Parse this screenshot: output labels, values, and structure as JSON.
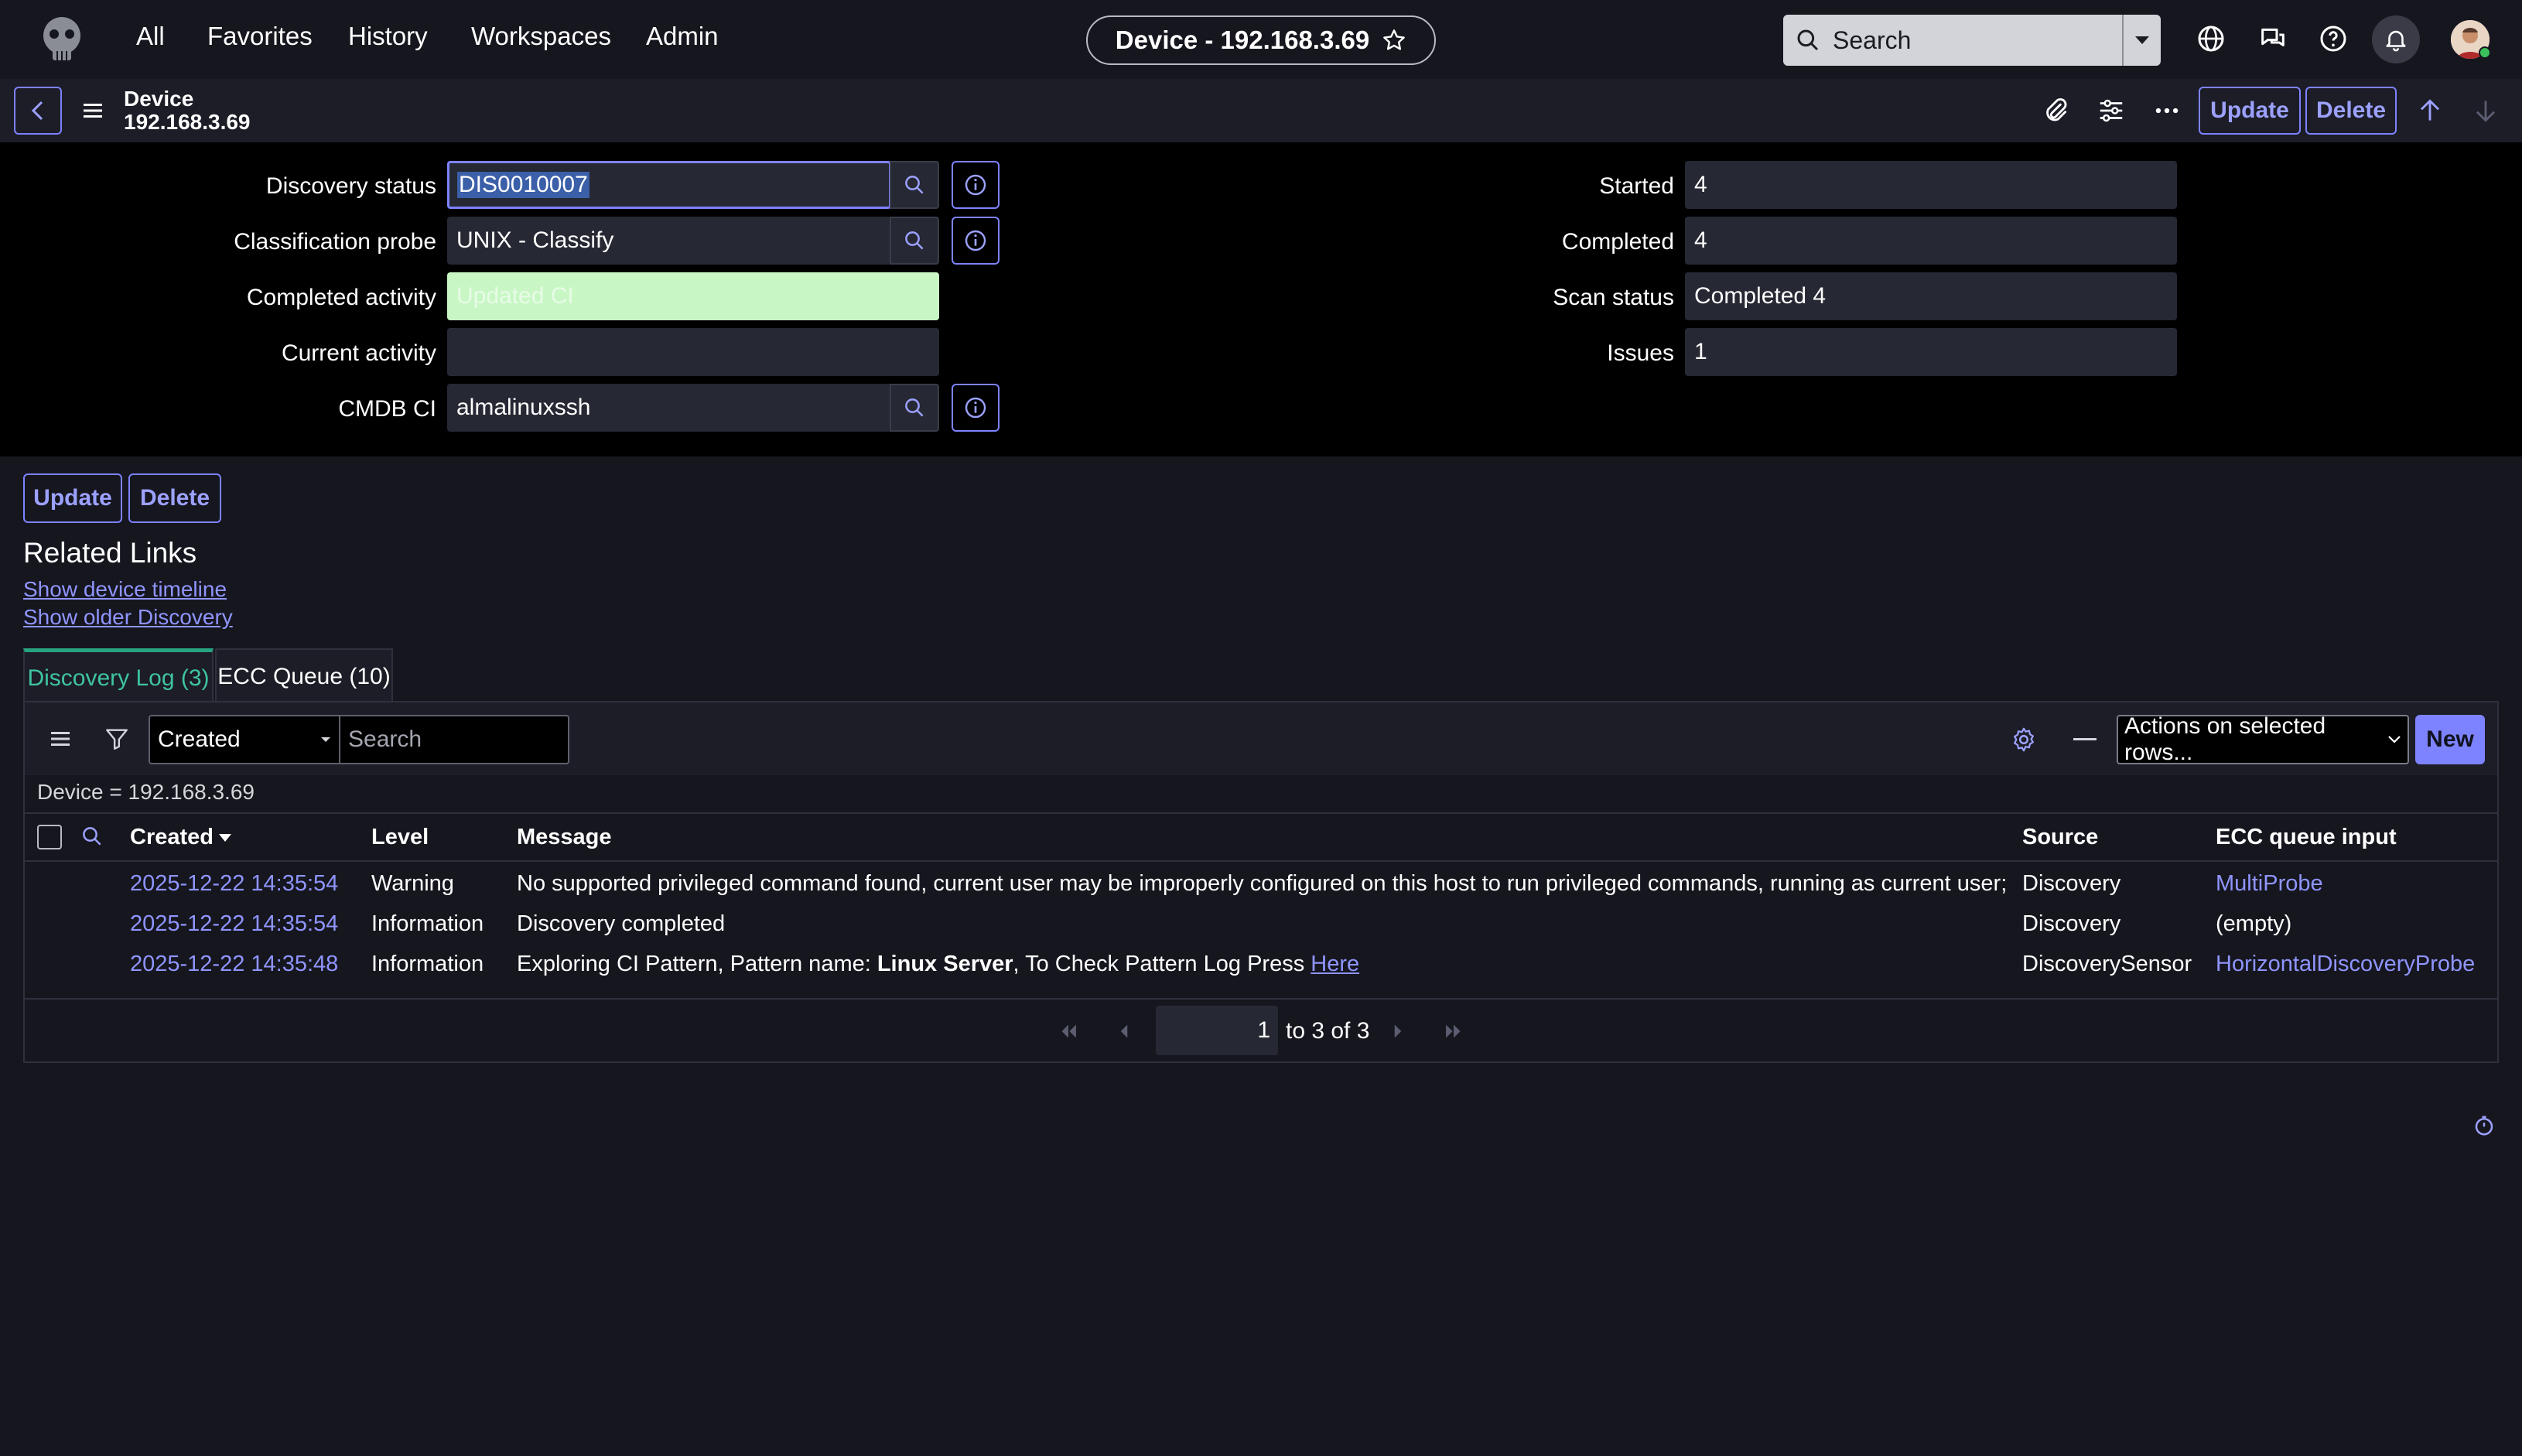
{
  "topnav": {
    "links": [
      "All",
      "Favorites",
      "History",
      "Workspaces",
      "Admin"
    ],
    "title": "Device - 192.168.3.69",
    "search_placeholder": "Search"
  },
  "form_header": {
    "table": "Device",
    "record": "192.168.3.69",
    "update_label": "Update",
    "delete_label": "Delete"
  },
  "form": {
    "left": [
      {
        "label": "Discovery status",
        "value": "DIS0010007"
      },
      {
        "label": "Classification probe",
        "value": "UNIX - Classify"
      },
      {
        "label": "Completed activity",
        "value": "Updated CI"
      },
      {
        "label": "Current activity",
        "value": ""
      },
      {
        "label": "CMDB CI",
        "value": "almalinuxssh"
      }
    ],
    "right": [
      {
        "label": "Started",
        "value": "4"
      },
      {
        "label": "Completed",
        "value": "4"
      },
      {
        "label": "Scan status",
        "value": "Completed 4"
      },
      {
        "label": "Issues",
        "value": "1"
      }
    ]
  },
  "bottom_buttons": {
    "update_label": "Update",
    "delete_label": "Delete"
  },
  "related_links": {
    "title": "Related Links",
    "links": [
      "Show device timeline",
      "Show older Discovery"
    ]
  },
  "tabs": [
    {
      "label": "Discovery Log (3)",
      "active": true
    },
    {
      "label": "ECC Queue (10)",
      "active": false
    }
  ],
  "list": {
    "filter_field": "Created",
    "search_placeholder": "Search",
    "actions_label": "Actions on selected rows...",
    "new_label": "New",
    "breadcrumb": "Device = 192.168.3.69",
    "columns": [
      "Created",
      "Level",
      "Message",
      "Source",
      "ECC queue input"
    ],
    "rows": [
      {
        "created": "2025-12-22 14:35:54",
        "level": "Warning",
        "message": "No supported privileged command found, current user may be improperly configured on this host to run privileged commands, running as current user;",
        "source": "Discovery",
        "ecc": "MultiProbe",
        "ecc_is_link": true
      },
      {
        "created": "2025-12-22 14:35:54",
        "level": "Information",
        "message": "Discovery completed",
        "source": "Discovery",
        "ecc": "(empty)",
        "ecc_is_link": false
      },
      {
        "created": "2025-12-22 14:35:48",
        "level": "Information",
        "message_prefix": "Exploring CI Pattern, Pattern name: ",
        "message_bold": "Linux Server",
        "message_mid": ", To Check Pattern Log Press ",
        "message_link": "Here",
        "source": "DiscoverySensor",
        "ecc": "HorizontalDiscoveryProbe",
        "ecc_is_link": true
      }
    ],
    "pager": {
      "page": "1",
      "range_text": "to 3 of 3"
    }
  },
  "colors": {
    "accent": "#7d83ff",
    "link": "#8f95ff",
    "tab_active": "#3fc4a0",
    "completed_activity_bg": "#c8f7c5"
  }
}
